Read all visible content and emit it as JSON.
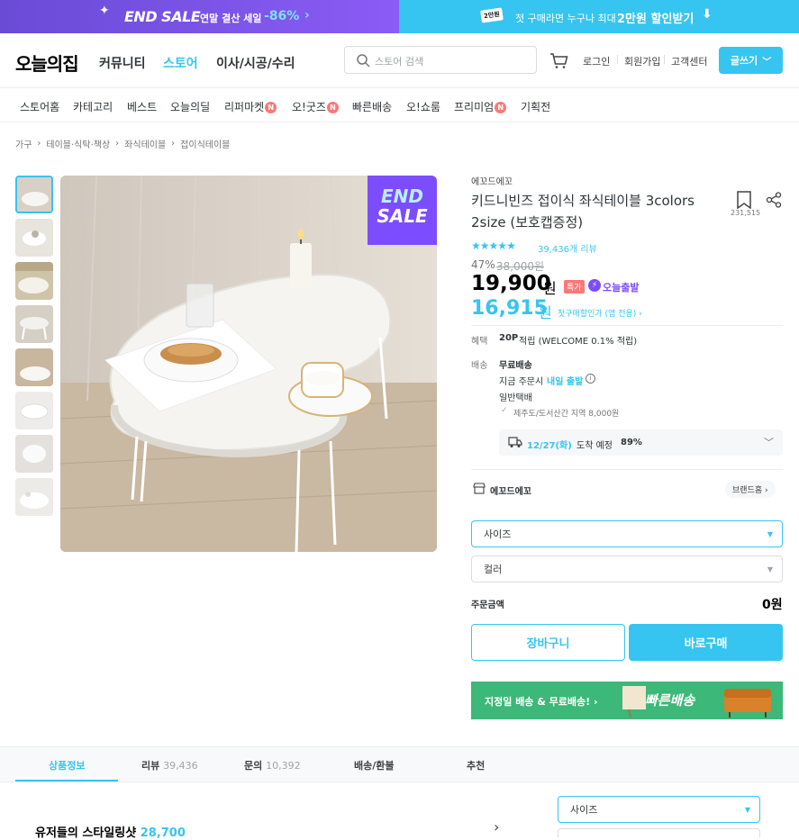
{
  "banner": {
    "end_sale": "END SALE",
    "year_end_sale": "연말 결산 세일",
    "discount": "-86%",
    "coupon_badge": "2만원",
    "coupon_text": "첫 구매라면 누구나 최대",
    "coupon_amount": "2만원 할인받기"
  },
  "header": {
    "logo": "오늘의집",
    "nav": [
      "커뮤니티",
      "스토어",
      "이사/시공/수리"
    ],
    "search_placeholder": "스토어 검색",
    "login": "로그인",
    "signup": "회원가입",
    "support": "고객센터",
    "write": "글쓰기"
  },
  "subnav": [
    "스토어홈",
    "카테고리",
    "베스트",
    "오늘의딜",
    "리퍼마켓",
    "오!굿즈",
    "빠른배송",
    "오!쇼룸",
    "프리미엄",
    "기획전"
  ],
  "new_badge": "N",
  "breadcrumb": [
    "가구",
    "테이블·식탁·책상",
    "좌식테이블",
    "접이식테이블"
  ],
  "photo": {
    "end_label_1": "END",
    "end_label_2": "SALE"
  },
  "product": {
    "brand": "에꼬드에꼬",
    "title_line1": "키드니빈즈 접이식 좌식테이블 3colors",
    "title_line2": "2size (보호캡증정)",
    "bookmark_count": "231,515",
    "rating": 4.5,
    "review_count": "39,436개 리뷰",
    "discount_rate": "47%",
    "original_price": "38,000원",
    "price": "19,900",
    "price_unit": "원",
    "special_badge": "특가",
    "today_ship": "오늘출발",
    "first_price": "16,915",
    "first_price_unit": "원",
    "first_price_label": "첫구매할인가 (앱 전용)"
  },
  "benefit": {
    "label": "혜택",
    "points": "20P",
    "points_detail": "적립 (WELCOME 0.1% 적립)"
  },
  "shipping": {
    "label": "배송",
    "free": "무료배송",
    "order_now": "지금 주문시",
    "tomorrow": "내일 출발",
    "normal": "일반택배",
    "jeju": "제주도/도서산간 지역 8,000원",
    "arrival_date": "12/27(화)",
    "arrival_text": "도착 예정",
    "arrival_rate": "89%"
  },
  "store": {
    "name": "에꼬드에꼬",
    "home": "브랜드홈"
  },
  "options": {
    "size": "사이즈",
    "color": "컬러"
  },
  "order": {
    "label": "주문금액",
    "amount": "0원"
  },
  "buttons": {
    "cart": "장바구니",
    "buy": "바로구매"
  },
  "promo": {
    "text": "지정일 배송 & 무료배송!",
    "fast": "빠른배송"
  },
  "tabs": [
    {
      "label": "상품정보",
      "count": ""
    },
    {
      "label": "리뷰",
      "count": "39,436"
    },
    {
      "label": "문의",
      "count": "10,392"
    },
    {
      "label": "배송/환불",
      "count": ""
    },
    {
      "label": "추천",
      "count": ""
    }
  ],
  "bottom": {
    "styling_title": "유저들의 스타일링샷",
    "styling_count": "28,700",
    "size": "사이즈"
  },
  "colors": {
    "accent": "#35c5f0",
    "brand_purple": "#7c4dff",
    "green": "#3cb878"
  }
}
